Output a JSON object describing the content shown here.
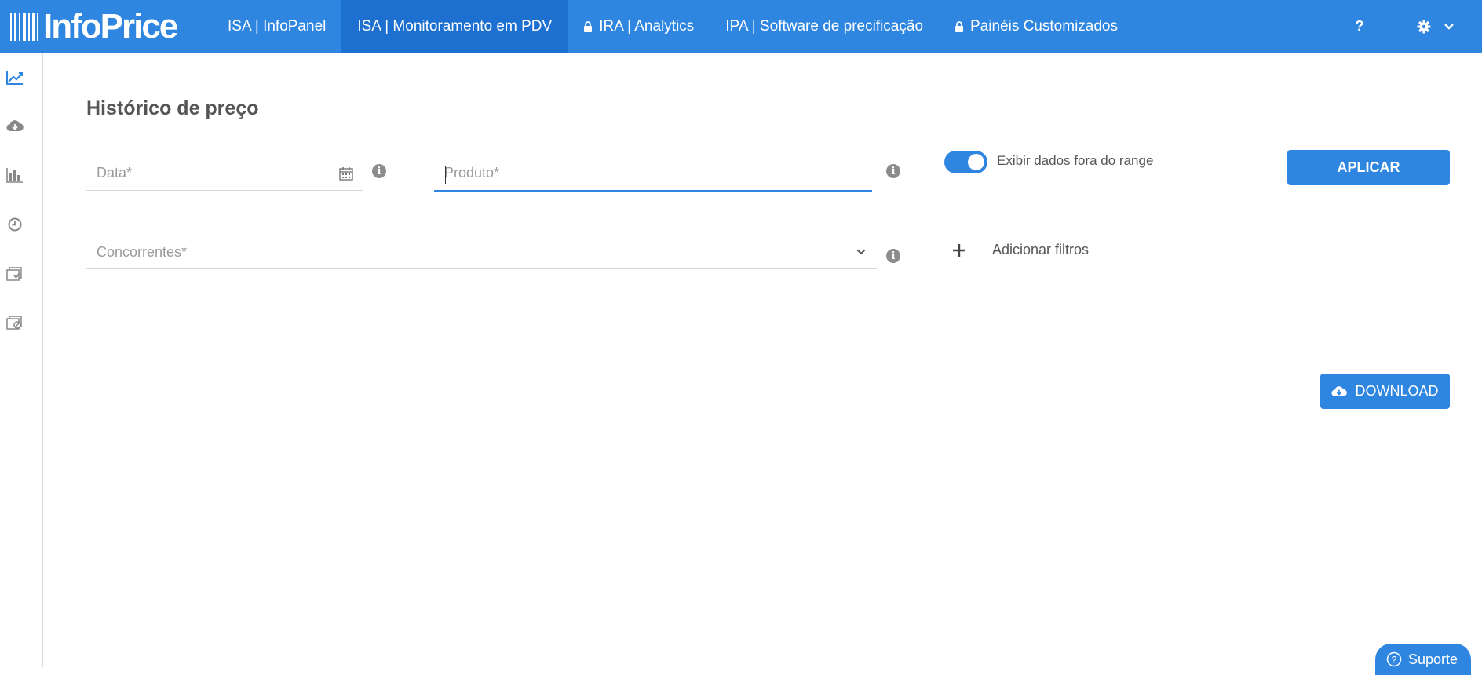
{
  "brand": {
    "logo_text": "InfoPrice"
  },
  "nav": {
    "items": [
      {
        "label": "ISA | InfoPanel",
        "active": false,
        "locked": false
      },
      {
        "label": "ISA | Monitoramento em PDV",
        "active": true,
        "locked": false
      },
      {
        "label": "IRA | Analytics",
        "active": false,
        "locked": true
      },
      {
        "label": "IPA | Software de precificação",
        "active": false,
        "locked": false
      },
      {
        "label": "Painéis Customizados",
        "active": false,
        "locked": true
      }
    ],
    "help_label": "?"
  },
  "sidebar": {
    "items": [
      {
        "icon": "line-chart-icon",
        "active": true
      },
      {
        "icon": "cloud-download-icon",
        "active": false
      },
      {
        "icon": "bar-chart-icon",
        "active": false
      },
      {
        "icon": "clock-icon",
        "active": false
      },
      {
        "icon": "checklist-icon",
        "active": false
      },
      {
        "icon": "blocked-list-icon",
        "active": false
      }
    ]
  },
  "page": {
    "title": "Histórico de preço"
  },
  "filters": {
    "date_placeholder": "Data*",
    "product_placeholder": "Produto*",
    "competitors_placeholder": "Concorrentes*",
    "toggle_label": "Exibir dados fora do range",
    "toggle_on": true,
    "apply_label": "APLICAR",
    "add_filters_label": "Adicionar filtros"
  },
  "download": {
    "label": "DOWNLOAD"
  },
  "support": {
    "label": "Suporte"
  },
  "colors": {
    "primary": "#2f86e1",
    "nav_active": "#1d6fd0"
  }
}
